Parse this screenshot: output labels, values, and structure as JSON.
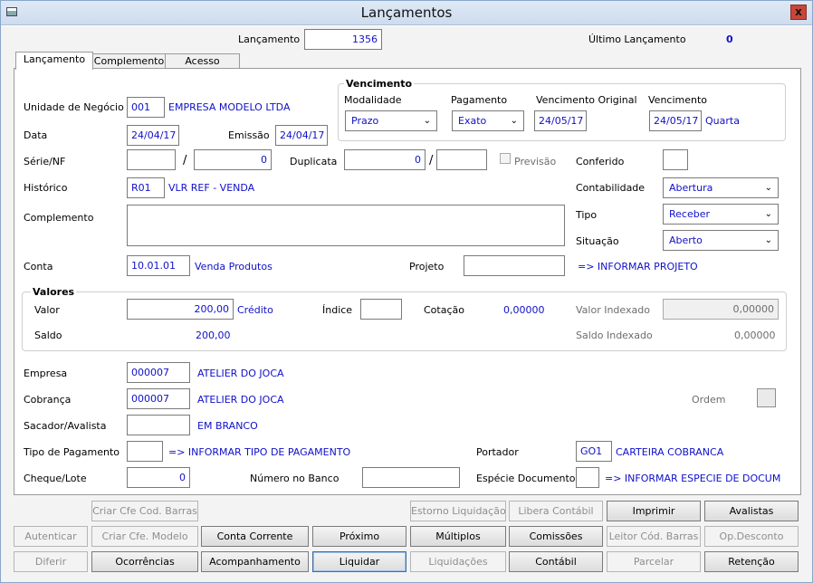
{
  "window": {
    "title": "Lançamentos",
    "close_glyph": "x"
  },
  "header": {
    "lancamento_label": "Lançamento",
    "lancamento_value": "1356",
    "ultimo_label": "Último Lançamento",
    "ultimo_value": "0"
  },
  "tabs": [
    {
      "label": "Lançamento"
    },
    {
      "label": "Complemento"
    },
    {
      "label": "Acesso"
    }
  ],
  "vencimento": {
    "title": "Vencimento",
    "modalidade_label": "Modalidade",
    "modalidade_value": "Prazo",
    "pagamento_label": "Pagamento",
    "pagamento_value": "Exato",
    "venc_original_label": "Vencimento Original",
    "venc_original_value": "24/05/17",
    "venc_label": "Vencimento",
    "venc_value": "24/05/17",
    "venc_weekday": "Quarta"
  },
  "form": {
    "unidade_label": "Unidade de Negócio",
    "unidade_code": "001",
    "unidade_name": "EMPRESA MODELO LTDA",
    "data_label": "Data",
    "data_value": "24/04/17",
    "emissao_label": "Emissão",
    "emissao_value": "24/04/17",
    "serie_label": "Série/NF",
    "serie_value": "",
    "slash": "/",
    "nf_value": "0",
    "duplicata_label": "Duplicata",
    "duplicata_value": "0",
    "duplicata_extra": "",
    "previsao_label": "Previsão",
    "conferido_label": "Conferido",
    "historico_label": "Histórico",
    "historico_code": "R01",
    "historico_desc": "VLR REF - VENDA",
    "contabilidade_label": "Contabilidade",
    "contabilidade_value": "Abertura",
    "complemento_label": "Complemento",
    "tipo_label": "Tipo",
    "tipo_value": "Receber",
    "situacao_label": "Situação",
    "situacao_value": "Aberto",
    "conta_label": "Conta",
    "conta_code": "10.01.01",
    "conta_desc": "Venda Produtos",
    "projeto_label": "Projeto",
    "projeto_hint": "=> INFORMAR PROJETO"
  },
  "valores": {
    "title": "Valores",
    "valor_label": "Valor",
    "valor_value": "200,00",
    "valor_tipo": "Crédito",
    "indice_label": "Índice",
    "cotacao_label": "Cotação",
    "cotacao_value": "0,00000",
    "valor_indexado_label": "Valor Indexado",
    "valor_indexado_value": "0,00000",
    "saldo_label": "Saldo",
    "saldo_value": "200,00",
    "saldo_indexado_label": "Saldo Indexado",
    "saldo_indexado_value": "0,00000"
  },
  "parties": {
    "empresa_label": "Empresa",
    "empresa_code": "000007",
    "empresa_name": "ATELIER DO JOCA",
    "cobranca_label": "Cobrança",
    "cobranca_code": "000007",
    "cobranca_name": "ATELIER DO JOCA",
    "ordem_label": "Ordem",
    "sacador_label": "Sacador/Avalista",
    "sacador_name": "EM BRANCO",
    "tipo_pag_label": "Tipo de Pagamento",
    "tipo_pag_hint": "=> INFORMAR TIPO DE PAGAMENTO",
    "portador_label": "Portador",
    "portador_code": "GO1",
    "portador_name": "CARTEIRA COBRANCA",
    "cheque_label": "Cheque/Lote",
    "cheque_value": "0",
    "numero_banco_label": "Número no Banco",
    "especie_label": "Espécie Documento",
    "especie_hint": "=> INFORMAR ESPECIE DE DOCUM"
  },
  "buttons": {
    "criar_cfe_barras": "Criar Cfe Cod. Barras",
    "estorno": "Estorno Liquidação",
    "libera_contabil": "Libera Contábil",
    "imprimir": "Imprimir",
    "avalistas": "Avalistas",
    "autenticar": "Autenticar",
    "criar_cfe_modelo": "Criar Cfe. Modelo",
    "conta_corrente": "Conta Corrente",
    "proximo": "Próximo",
    "multiplos": "Múltiplos",
    "comissoes": "Comissões",
    "leitor_barras": "Leitor Cód. Barras",
    "op_desconto": "Op.Desconto",
    "diferir": "Diferir",
    "ocorrencias": "Ocorrências",
    "acompanhamento": "Acompanhamento",
    "liquidar": "Liquidar",
    "liquidacoes": "Liquidações",
    "contabil": "Contábil",
    "parcelar": "Parcelar",
    "retencao": "Retenção"
  }
}
